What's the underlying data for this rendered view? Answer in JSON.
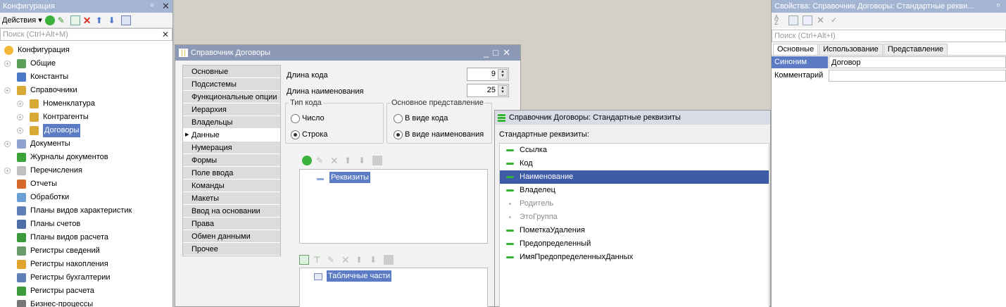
{
  "config_panel": {
    "title": "Конфигурация",
    "actions_label": "Действия",
    "search_placeholder": "Поиск (Ctrl+Alt+M)",
    "tree": [
      {
        "label": "Конфигурация",
        "icon": "config-root-icon",
        "level": 0
      },
      {
        "label": "Общие",
        "icon": "common-icon",
        "level": 1,
        "expander": true
      },
      {
        "label": "Константы",
        "icon": "constants-icon",
        "level": 1
      },
      {
        "label": "Справочники",
        "icon": "catalogs-icon",
        "level": 1,
        "expander": true
      },
      {
        "label": "Номенклатура",
        "icon": "catalog-icon",
        "level": 2,
        "expander": true
      },
      {
        "label": "Контрагенты",
        "icon": "catalog-icon",
        "level": 2,
        "expander": true
      },
      {
        "label": "Договоры",
        "icon": "catalog-icon",
        "level": 2,
        "expander": true,
        "selected": true
      },
      {
        "label": "Документы",
        "icon": "documents-icon",
        "level": 1,
        "expander": true
      },
      {
        "label": "Журналы документов",
        "icon": "journals-icon",
        "level": 1
      },
      {
        "label": "Перечисления",
        "icon": "enums-icon",
        "level": 1,
        "expander": true
      },
      {
        "label": "Отчеты",
        "icon": "reports-icon",
        "level": 1
      },
      {
        "label": "Обработки",
        "icon": "processing-icon",
        "level": 1
      },
      {
        "label": "Планы видов характеристик",
        "icon": "chart-types-icon",
        "level": 1
      },
      {
        "label": "Планы счетов",
        "icon": "chart-accounts-icon",
        "level": 1
      },
      {
        "label": "Планы видов расчета",
        "icon": "calc-types-icon",
        "level": 1
      },
      {
        "label": "Регистры сведений",
        "icon": "info-register-icon",
        "level": 1
      },
      {
        "label": "Регистры накопления",
        "icon": "accum-register-icon",
        "level": 1
      },
      {
        "label": "Регистры бухгалтерии",
        "icon": "acc-register-icon",
        "level": 1
      },
      {
        "label": "Регистры расчета",
        "icon": "calc-register-icon",
        "level": 1
      },
      {
        "label": "Бизнес-процессы",
        "icon": "business-process-icon",
        "level": 1
      }
    ]
  },
  "catalog_window": {
    "title": "Справочник Договоры",
    "nav": [
      "Основные",
      "Подсистемы",
      "Функциональные опции",
      "Иерархия",
      "Владельцы",
      "Данные",
      "Нумерация",
      "Формы",
      "Поле ввода",
      "Команды",
      "Макеты",
      "Ввод на основании",
      "Права",
      "Обмен данными",
      "Прочее"
    ],
    "active_nav": "Данные",
    "code_length_label": "Длина кода",
    "code_length_value": "9",
    "name_length_label": "Длина наименования",
    "name_length_value": "25",
    "code_type_legend": "Тип кода",
    "code_type_options": [
      "Число",
      "Строка"
    ],
    "code_type_selected": "Строка",
    "main_repr_legend": "Основное представление",
    "main_repr_options": [
      "В виде кода",
      "В виде наименования"
    ],
    "main_repr_selected": "В виде наименования",
    "attributes_node": "Реквизиты",
    "tabular_node": "Табличные части"
  },
  "std_window": {
    "title": "Справочник Договоры: Стандартные реквизиты",
    "list_label": "Стандартные реквизиты:",
    "items": [
      {
        "label": "Ссылка",
        "state": "normal"
      },
      {
        "label": "Код",
        "state": "normal"
      },
      {
        "label": "Наименование",
        "state": "selected"
      },
      {
        "label": "Владелец",
        "state": "normal"
      },
      {
        "label": "Родитель",
        "state": "disabled"
      },
      {
        "label": "ЭтоГруппа",
        "state": "disabled"
      },
      {
        "label": "ПометкаУдаления",
        "state": "normal"
      },
      {
        "label": "Предопределенный",
        "state": "normal"
      },
      {
        "label": "ИмяПредопределенныхДанных",
        "state": "normal"
      }
    ]
  },
  "props_panel": {
    "title": "Свойства: Справочник Договоры: Стандартные рекви...",
    "search_placeholder": "Поиск (Ctrl+Alt+I)",
    "tabs": [
      "Основные",
      "Использование",
      "Представление"
    ],
    "active_tab": "Основные",
    "rows": [
      {
        "label": "Синоним",
        "value": "Договор",
        "selected": true
      },
      {
        "label": "Комментарий",
        "value": "",
        "selected": false
      }
    ]
  },
  "colors": {
    "selection": "#5b7bc4",
    "accent_green": "#33b533",
    "title_bar": "#a4b5d4"
  }
}
